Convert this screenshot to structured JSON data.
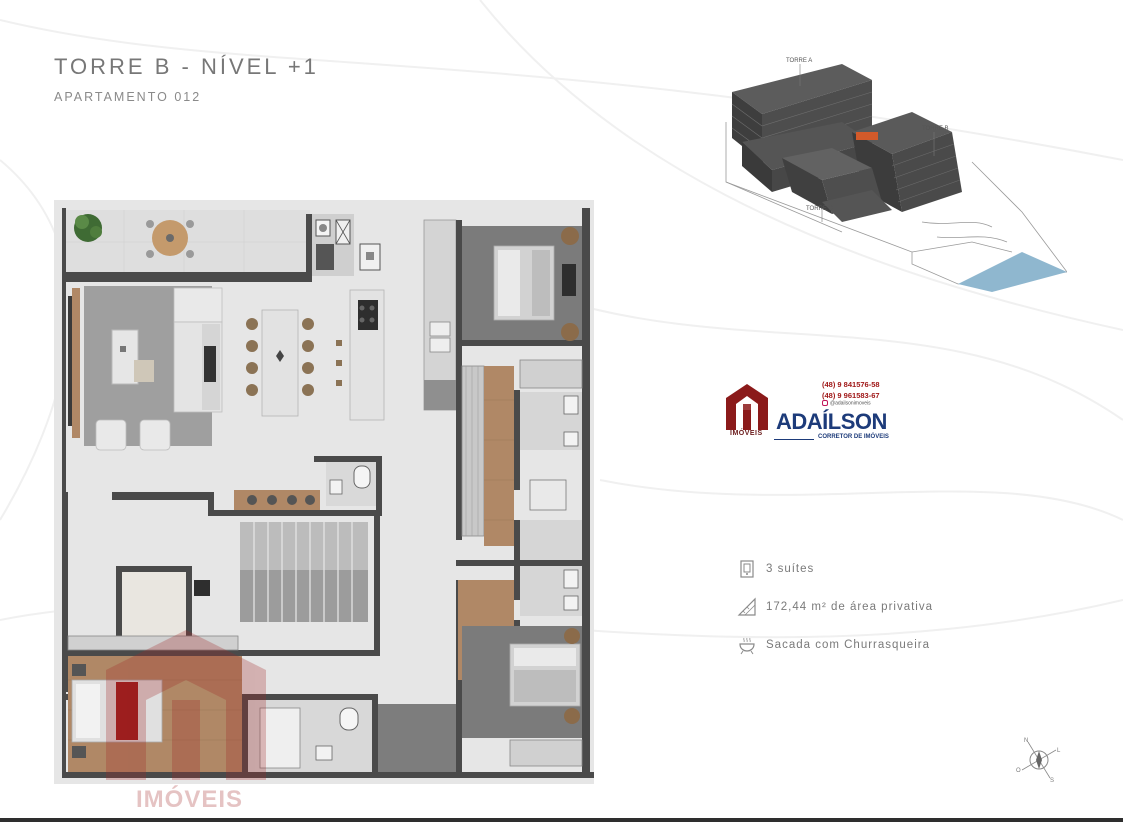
{
  "header": {
    "title": "TORRE B - NÍVEL +1",
    "subtitle": "APARTAMENTO 012"
  },
  "building": {
    "label_a": "TORRE A",
    "label_b": "TORRE B",
    "label_c": "TORRE C"
  },
  "logo": {
    "phone_1": "(48) 9 841576-58",
    "phone_2": "(48) 9 961583-67",
    "instagram": "@adailsonimoveis",
    "brand": "ADAÍLSON",
    "mark_label": "IMÓVEIS",
    "tagline": "CORRETOR DE IMÓVEIS"
  },
  "features": [
    {
      "icon": "door-icon",
      "label": "3 suítes"
    },
    {
      "icon": "area-ruler-icon",
      "label": "172,44 m² de área privativa"
    },
    {
      "icon": "barbecue-icon",
      "label": "Sacada com Churrasqueira"
    }
  ],
  "compass": {
    "n": "N",
    "s": "S",
    "l": "L",
    "o": "O"
  },
  "watermark": {
    "text": "IMÓVEIS"
  },
  "colors": {
    "wall": "#4a4a4a",
    "floor_tile": "#dcdcdc",
    "wood": "#b08866",
    "carpet": "#9a9a9a",
    "brand_blue": "#1d3b7a",
    "brand_red": "#8b1a1a"
  }
}
